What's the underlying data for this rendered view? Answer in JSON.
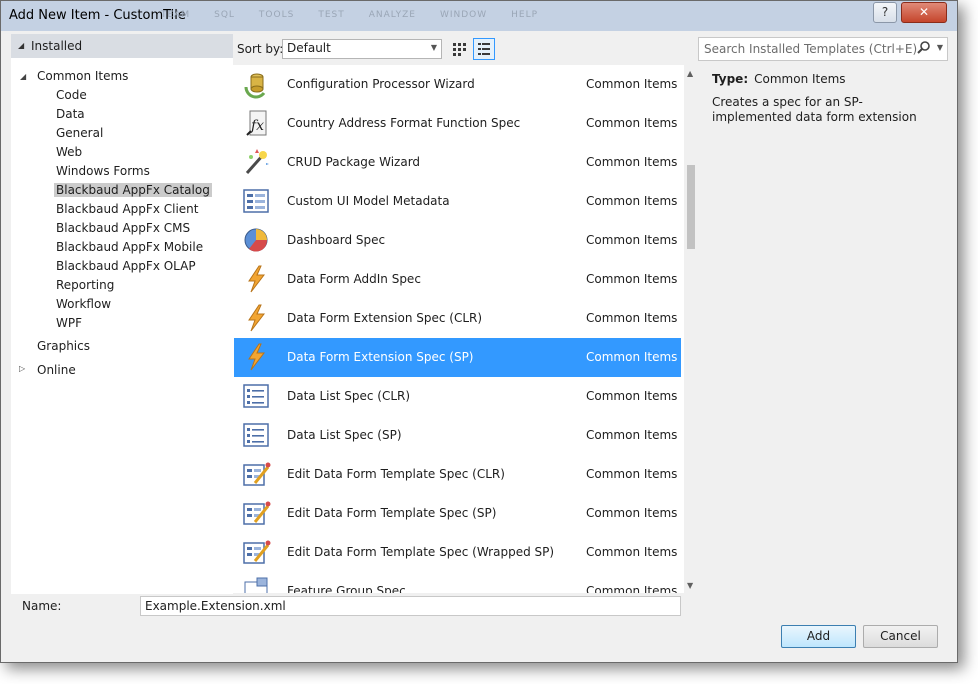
{
  "window": {
    "title": "Add New Item - CustomTile",
    "help_label": "?",
    "close_label": "✕"
  },
  "menubar_ghost": [
    "TEAM",
    "SQL",
    "TOOLS",
    "TEST",
    "ANALYZE",
    "WINDOW",
    "HELP"
  ],
  "tree": {
    "installed_label": "Installed",
    "items": [
      {
        "label": "Common Items",
        "level": 1,
        "expanded": true
      },
      {
        "label": "Code",
        "level": 2
      },
      {
        "label": "Data",
        "level": 2
      },
      {
        "label": "General",
        "level": 2
      },
      {
        "label": "Web",
        "level": 2
      },
      {
        "label": "Windows Forms",
        "level": 2
      },
      {
        "label": "Blackbaud AppFx Catalog",
        "level": 2,
        "selected": true
      },
      {
        "label": "Blackbaud AppFx Client",
        "level": 2
      },
      {
        "label": "Blackbaud AppFx CMS",
        "level": 2
      },
      {
        "label": "Blackbaud AppFx Mobile",
        "level": 2
      },
      {
        "label": "Blackbaud AppFx OLAP",
        "level": 2
      },
      {
        "label": "Reporting",
        "level": 2
      },
      {
        "label": "Workflow",
        "level": 2
      },
      {
        "label": "WPF",
        "level": 2
      },
      {
        "label": "Graphics",
        "level": 1
      }
    ],
    "online_label": "Online"
  },
  "toolbar": {
    "sort_label": "Sort by:",
    "sort_value": "Default"
  },
  "search": {
    "placeholder": "Search Installed Templates (Ctrl+E)"
  },
  "templates": [
    {
      "name": "Configuration Processor Wizard",
      "category": "Common Items",
      "icon": "gear-cylinder-icon"
    },
    {
      "name": "Country Address Format Function Spec",
      "category": "Common Items",
      "icon": "function-fx-icon"
    },
    {
      "name": "CRUD Package Wizard",
      "category": "Common Items",
      "icon": "wizard-wand-icon"
    },
    {
      "name": "Custom UI Model Metadata",
      "category": "Common Items",
      "icon": "form-grid-icon"
    },
    {
      "name": "Dashboard Spec",
      "category": "Common Items",
      "icon": "pie-chart-icon"
    },
    {
      "name": "Data Form AddIn Spec",
      "category": "Common Items",
      "icon": "lightning-icon"
    },
    {
      "name": "Data Form Extension Spec (CLR)",
      "category": "Common Items",
      "icon": "lightning-icon"
    },
    {
      "name": "Data Form Extension Spec (SP)",
      "category": "Common Items",
      "icon": "lightning-icon",
      "selected": true
    },
    {
      "name": "Data List Spec (CLR)",
      "category": "Common Items",
      "icon": "list-icon"
    },
    {
      "name": "Data List Spec (SP)",
      "category": "Common Items",
      "icon": "list-icon"
    },
    {
      "name": "Edit Data Form Template Spec (CLR)",
      "category": "Common Items",
      "icon": "edit-form-icon"
    },
    {
      "name": "Edit Data Form Template Spec (SP)",
      "category": "Common Items",
      "icon": "edit-form-icon"
    },
    {
      "name": "Edit Data Form Template Spec (Wrapped SP)",
      "category": "Common Items",
      "icon": "edit-form-icon"
    },
    {
      "name": "Feature Group Spec",
      "category": "Common Items",
      "icon": "feature-group-icon"
    }
  ],
  "detail": {
    "type_label": "Type:",
    "type_value": "Common Items",
    "description": "Creates a spec for an SP-implemented data form extension"
  },
  "name_field": {
    "label": "Name:",
    "value": "Example.Extension.xml"
  },
  "buttons": {
    "add": "Add",
    "cancel": "Cancel"
  },
  "colors": {
    "selection": "#3399ff",
    "tree_selection": "#cbcbcb",
    "titlebar": "#c4d1e3",
    "close": "#c5452c"
  }
}
